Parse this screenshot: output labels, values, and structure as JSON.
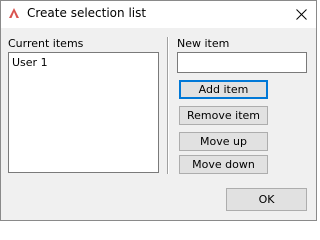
{
  "window": {
    "title": "Create selection list",
    "icon": "app-logo-icon",
    "close": "close-icon"
  },
  "left_panel": {
    "label": "Current items",
    "items": [
      "User 1"
    ]
  },
  "right_panel": {
    "label": "New item",
    "input_value": "",
    "buttons": {
      "add": "Add item",
      "remove": "Remove item",
      "move_up": "Move up",
      "move_down": "Move down"
    }
  },
  "footer": {
    "ok": "OK"
  }
}
